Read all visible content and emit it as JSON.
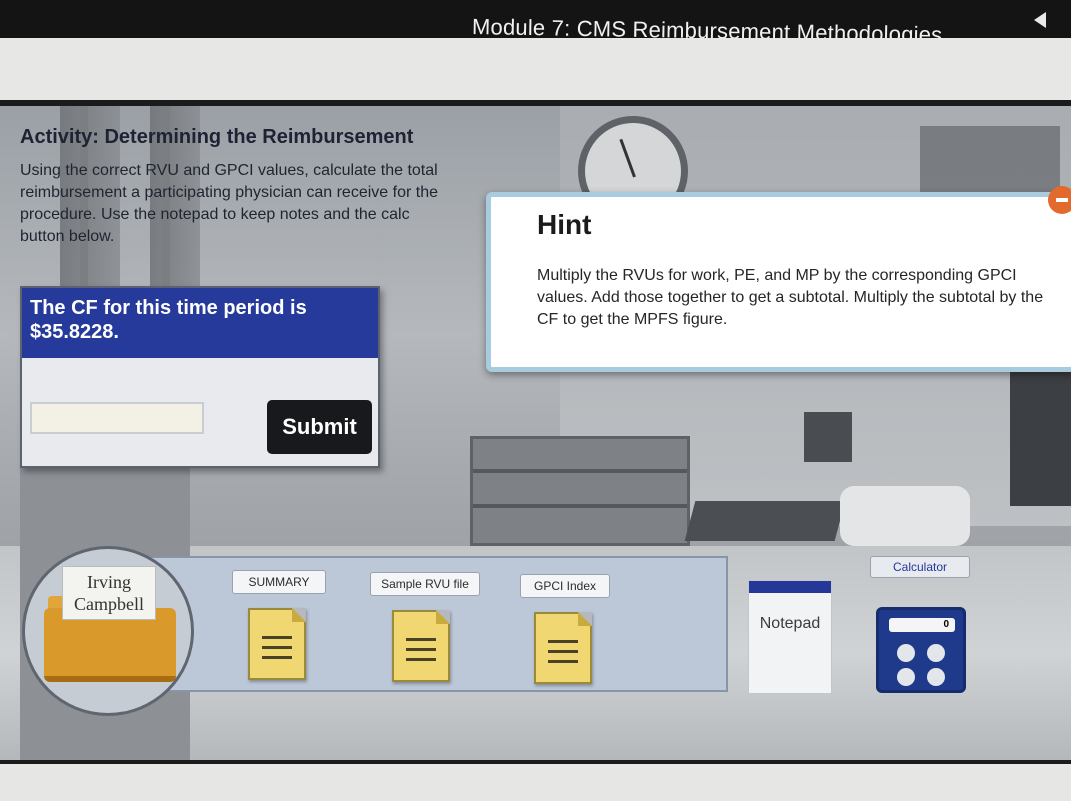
{
  "header": {
    "module_title": "Module 7: CMS Reimbursement Methodologies"
  },
  "activity": {
    "title": "Activity: Determining the Reimbursement",
    "instructions": "Using the correct RVU and GPCI values, calculate the total reimbursement a participating physician can receive for the\nprocedure. Use the notepad to keep notes and the calc\nbutton below."
  },
  "question": {
    "prompt": "The CF for this time period is $35.8228.",
    "answer_value": "",
    "submit_label": "Submit"
  },
  "hint": {
    "title": "Hint",
    "text": "Multiply the RVUs for work, PE, and MP by the corresponding GPCI values. Add those together to get a subtotal. Multiply the subtotal by the CF to get the MPFS figure."
  },
  "patient": {
    "name": "Irving Campbell"
  },
  "documents": [
    {
      "label": "SUMMARY"
    },
    {
      "label": "Sample RVU file"
    },
    {
      "label": "GPCI Index"
    }
  ],
  "tools": {
    "notepad_label": "Notepad",
    "calculator_label": "Calculator",
    "calculator_display": "0"
  },
  "colors": {
    "question_header": "#253a9a",
    "submit_button": "#17191d",
    "hint_border": "#a8cbe0",
    "folder": "#d99a2b",
    "calculator": "#1f3a8a"
  }
}
